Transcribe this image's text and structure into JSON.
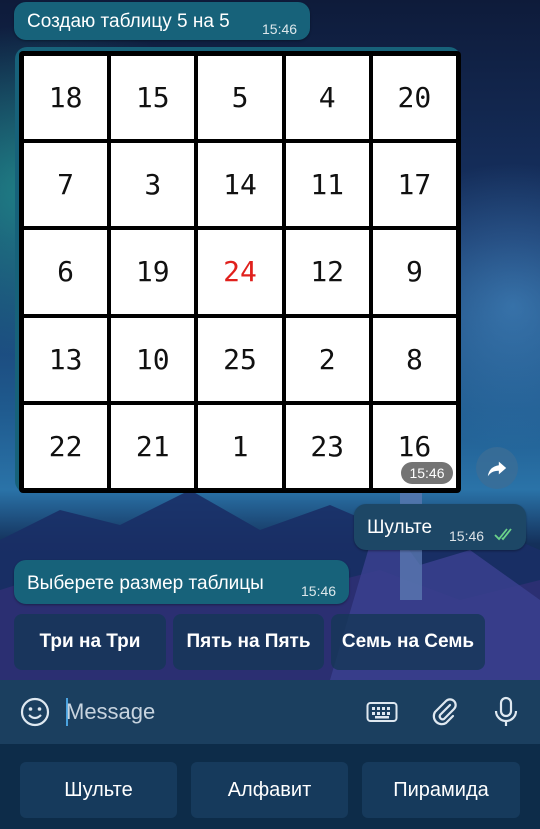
{
  "chat": {
    "messages": [
      {
        "text": "Создаю таблицу 5 на 5",
        "time": "15:46"
      },
      {
        "text": "Шульте",
        "time": "15:46"
      },
      {
        "text": "Выберете размер таблицы",
        "time": "15:46"
      }
    ],
    "image_time": "15:46",
    "table": {
      "rows": [
        [
          "18",
          "15",
          "5",
          "4",
          "20"
        ],
        [
          "7",
          "3",
          "14",
          "11",
          "17"
        ],
        [
          "6",
          "19",
          "24",
          "12",
          "9"
        ],
        [
          "13",
          "10",
          "25",
          "2",
          "8"
        ],
        [
          "22",
          "21",
          "1",
          "23",
          "16"
        ]
      ],
      "highlighted_value": "24",
      "highlight_color": "#e0201c"
    },
    "inline_buttons": [
      "Три на Три",
      "Пять на Пять",
      "Семь на Семь"
    ]
  },
  "input": {
    "placeholder": "Message"
  },
  "keyboard": {
    "buttons": [
      "Шульте",
      "Алфавит",
      "Пирамида"
    ]
  },
  "icons": {
    "emoji": "smile-icon",
    "bot_keyboard": "keyboard-icon",
    "attach": "paperclip-icon",
    "voice": "microphone-icon",
    "share": "share-arrow-icon",
    "read_status": "double-check-icon"
  }
}
